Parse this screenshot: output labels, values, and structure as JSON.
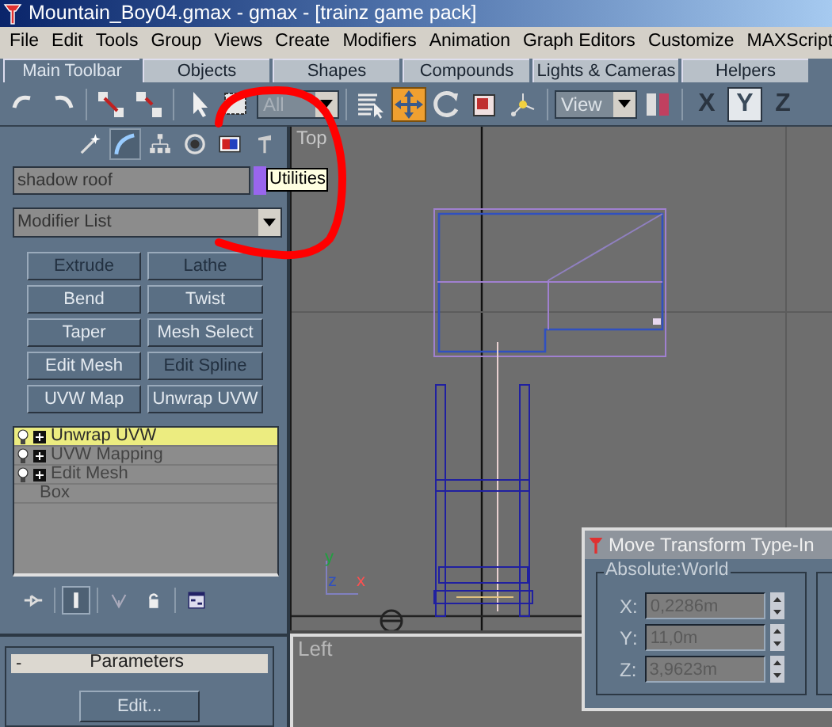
{
  "window": {
    "title": "Mountain_Boy04.gmax - gmax - [trainz game pack]"
  },
  "menu": [
    {
      "label": "File"
    },
    {
      "label": "Edit"
    },
    {
      "label": "Tools"
    },
    {
      "label": "Group"
    },
    {
      "label": "Views"
    },
    {
      "label": "Create"
    },
    {
      "label": "Modifiers"
    },
    {
      "label": "Animation"
    },
    {
      "label": "Graph Editors"
    },
    {
      "label": "Customize"
    },
    {
      "label": "MAXScript"
    }
  ],
  "tabs": [
    {
      "label": "Main Toolbar",
      "selected": true
    },
    {
      "label": "Objects",
      "selected": false
    },
    {
      "label": "Shapes",
      "selected": false
    },
    {
      "label": "Compounds",
      "selected": false
    },
    {
      "label": "Lights & Cameras",
      "selected": false
    },
    {
      "label": "Helpers",
      "selected": false
    }
  ],
  "toolbar": {
    "selection_filter": {
      "value": "All",
      "disabled": true
    },
    "transform_tools": [
      {
        "selected": true
      },
      {
        "selected": false
      },
      {
        "selected": false
      }
    ],
    "coordinate_system": {
      "value": "View"
    },
    "axis_constraints": [
      {
        "label": "X",
        "selected": false
      },
      {
        "label": "Y",
        "selected": true
      },
      {
        "label": "Z",
        "selected": false
      }
    ]
  },
  "command_panel": {
    "tabs": [
      {
        "selected": false
      },
      {
        "selected": true
      },
      {
        "selected": false
      },
      {
        "selected": false
      },
      {
        "selected": false
      },
      {
        "selected": false
      }
    ],
    "tooltip": "Utilities",
    "object_name": "shadow roof",
    "modifier_list": "Modifier List",
    "modifier_buttons": [
      {
        "label": "Extrude",
        "disabled": true
      },
      {
        "label": "Lathe",
        "disabled": true
      },
      {
        "label": "Bend",
        "disabled": false
      },
      {
        "label": "Twist",
        "disabled": false
      },
      {
        "label": "Taper",
        "disabled": false
      },
      {
        "label": "Mesh Select",
        "disabled": false
      },
      {
        "label": "Edit Mesh",
        "disabled": false
      },
      {
        "label": "Edit Spline",
        "disabled": true
      },
      {
        "label": "UVW Map",
        "disabled": false
      },
      {
        "label": "Unwrap UVW",
        "disabled": false
      }
    ],
    "stack": [
      {
        "label": "Unwrap UVW",
        "kind": "modifier",
        "selected": true
      },
      {
        "label": "UVW Mapping",
        "kind": "modifier",
        "selected": false
      },
      {
        "label": "Edit Mesh",
        "kind": "modifier",
        "selected": false
      },
      {
        "label": "Box",
        "kind": "base",
        "selected": false
      }
    ],
    "stack_tools": [
      {
        "selected": false
      },
      {
        "selected": true
      },
      {
        "selected": false
      },
      {
        "selected": false
      },
      {
        "selected": false
      }
    ],
    "rollout": {
      "toggle": "-",
      "title": "Parameters",
      "button": "Edit..."
    }
  },
  "viewports": [
    {
      "label": "Top",
      "axis_labels": [
        "y",
        "z",
        "x"
      ]
    },
    {
      "label": "Left"
    }
  ],
  "dialog": {
    "title": "Move Transform Type-In",
    "group": "Absolute:World",
    "fields": [
      {
        "axis": "X",
        "separator": ":",
        "value": "0,2286m",
        "disabled": true
      },
      {
        "axis": "Y",
        "separator": ":",
        "value": "11,0m",
        "disabled": true
      },
      {
        "axis": "Z",
        "separator": ":",
        "value": "3,9623m",
        "disabled": true
      }
    ]
  }
}
